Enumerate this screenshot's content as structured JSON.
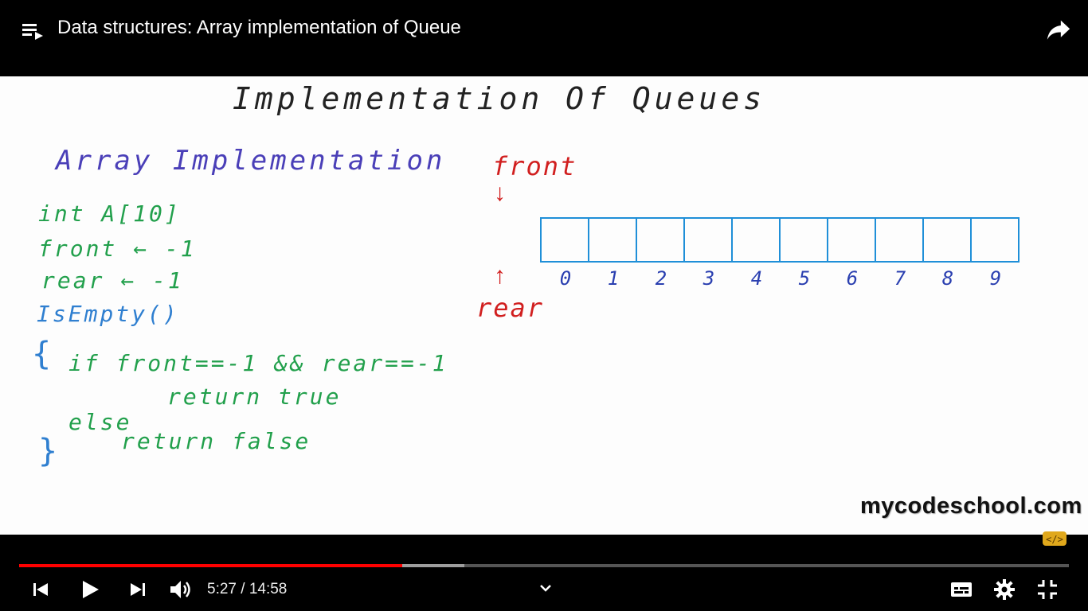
{
  "header": {
    "title": "Data structures: Array implementation of Queue"
  },
  "slide": {
    "title": "Implementation Of Queues",
    "subtitle": "Array Implementation",
    "code": {
      "line1": "int  A[10]",
      "line2": "front ← -1",
      "line3": "rear ← -1",
      "line4": "IsEmpty()",
      "open_brace": "{",
      "line5": "if  front==-1 && rear==-1",
      "line6": "return true",
      "line7": "else",
      "line8": "return false",
      "close_brace": "}"
    },
    "front_label": "front",
    "rear_label": "rear",
    "array_indices": [
      "0",
      "1",
      "2",
      "3",
      "4",
      "5",
      "6",
      "7",
      "8",
      "9"
    ],
    "watermark": "mycodeschool.com"
  },
  "player": {
    "time": "5:27 / 14:58",
    "progress_played": 0.365,
    "progress_buffered": 0.424,
    "icons": {
      "playlist": "playlist-icon",
      "share": "share-icon",
      "previous": "skip-previous-icon",
      "play": "play-icon",
      "next": "skip-next-icon",
      "volume": "volume-icon",
      "chevron": "chevron-down-icon",
      "captions": "subtitles-icon",
      "settings": "gear-icon",
      "fullscreen": "exit-fullscreen-icon"
    },
    "colors": {
      "progress": "#ff0000",
      "buffer": "#9e9e9e",
      "track": "#555555"
    }
  }
}
